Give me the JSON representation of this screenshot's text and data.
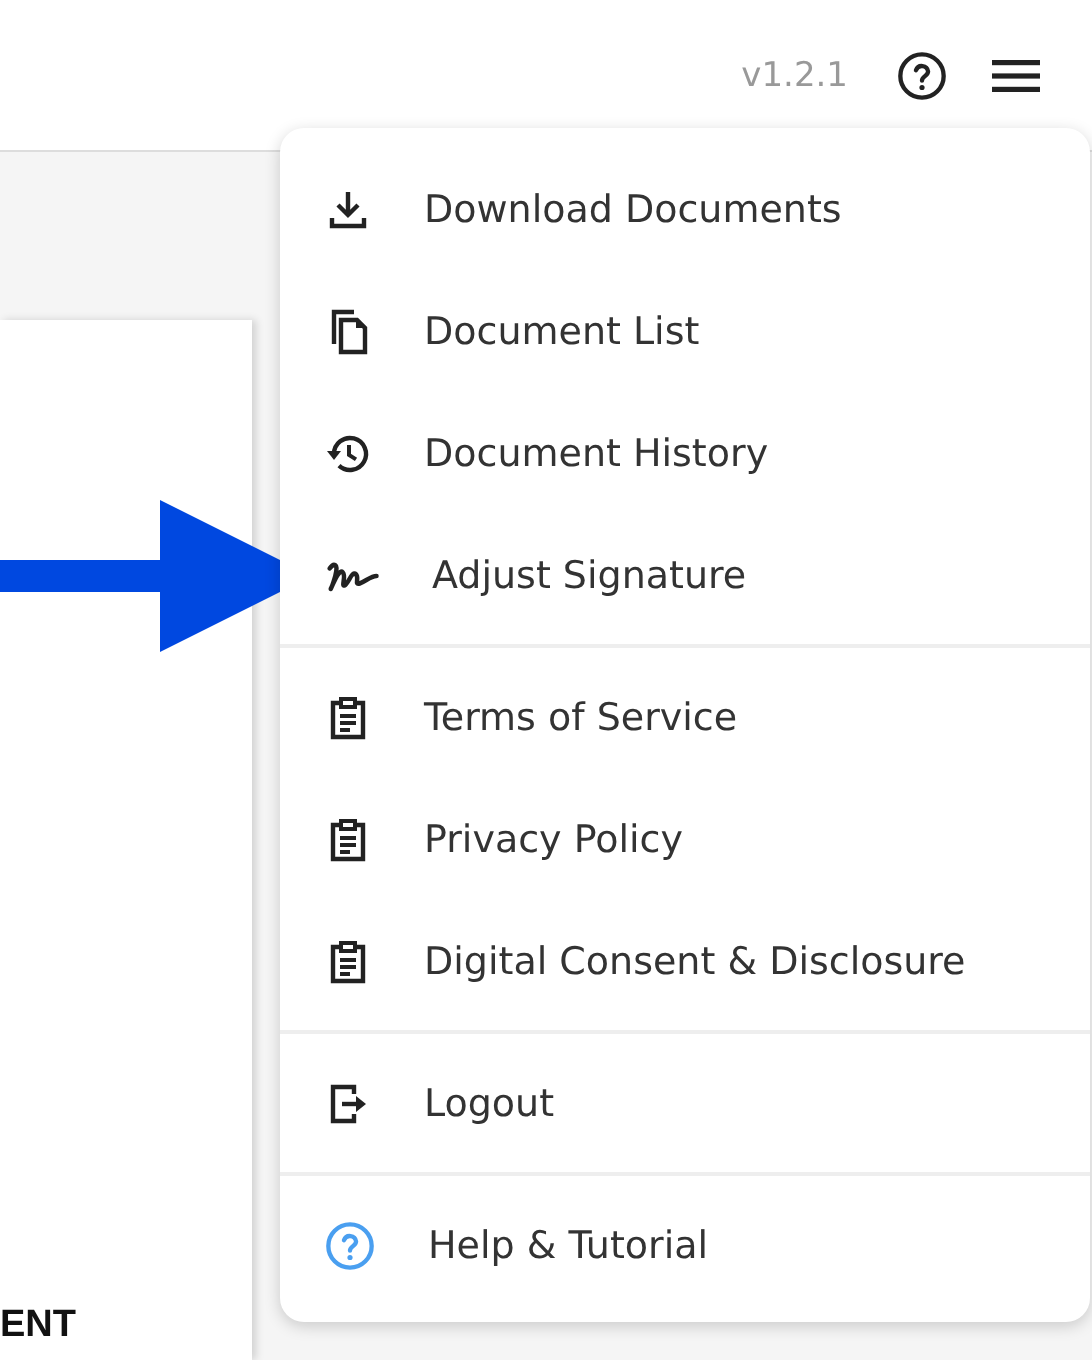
{
  "header": {
    "version": "v1.2.1"
  },
  "document": {
    "heading_fragment": "ENT"
  },
  "menu": {
    "sections": [
      {
        "items": [
          {
            "kind": "download",
            "label": "Download Documents"
          },
          {
            "kind": "copy",
            "label": "Document List"
          },
          {
            "kind": "history",
            "label": "Document History"
          },
          {
            "kind": "signature",
            "label": "Adjust Signature"
          }
        ]
      },
      {
        "items": [
          {
            "kind": "clipboard",
            "label": "Terms of Service"
          },
          {
            "kind": "clipboard",
            "label": "Privacy Policy"
          },
          {
            "kind": "clipboard",
            "label": "Digital Consent & Disclosure"
          }
        ]
      },
      {
        "items": [
          {
            "kind": "logout",
            "label": "Logout"
          }
        ]
      },
      {
        "items": [
          {
            "kind": "help",
            "label": "Help & Tutorial"
          }
        ]
      }
    ]
  }
}
